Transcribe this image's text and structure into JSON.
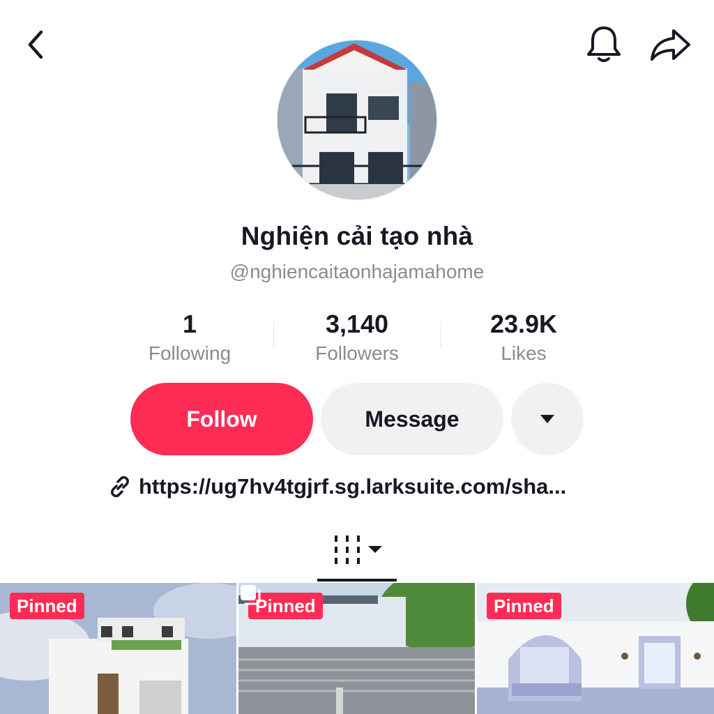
{
  "header": {
    "back_icon": "chevron-left-icon",
    "bell_icon": "bell-icon",
    "share_icon": "share-arrow-icon"
  },
  "profile": {
    "display_name": "Nghiện cải tạo nhà",
    "username": "@nghiencaitaonhajamahome",
    "avatar": "house-facade-photo"
  },
  "stats": {
    "following": {
      "value": "1",
      "label": "Following"
    },
    "followers": {
      "value": "3,140",
      "label": "Followers"
    },
    "likes": {
      "value": "23.9K",
      "label": "Likes"
    }
  },
  "actions": {
    "follow_label": "Follow",
    "message_label": "Message",
    "more_icon": "caret-down-icon"
  },
  "bio": {
    "link_icon": "link-icon",
    "link_text": "https://ug7hv4tgjrf.sg.larksuite.com/sha..."
  },
  "tabs": {
    "videos_icon": "grid-bars-icon",
    "dropdown_icon": "caret-down-icon"
  },
  "videos": [
    {
      "badge": "Pinned"
    },
    {
      "badge": "Pinned"
    },
    {
      "badge": "Pinned"
    }
  ],
  "colors": {
    "accent": "#fe2c55",
    "text_primary": "#161823",
    "text_secondary": "#8a8b91",
    "button_secondary": "#f1f1f2"
  }
}
